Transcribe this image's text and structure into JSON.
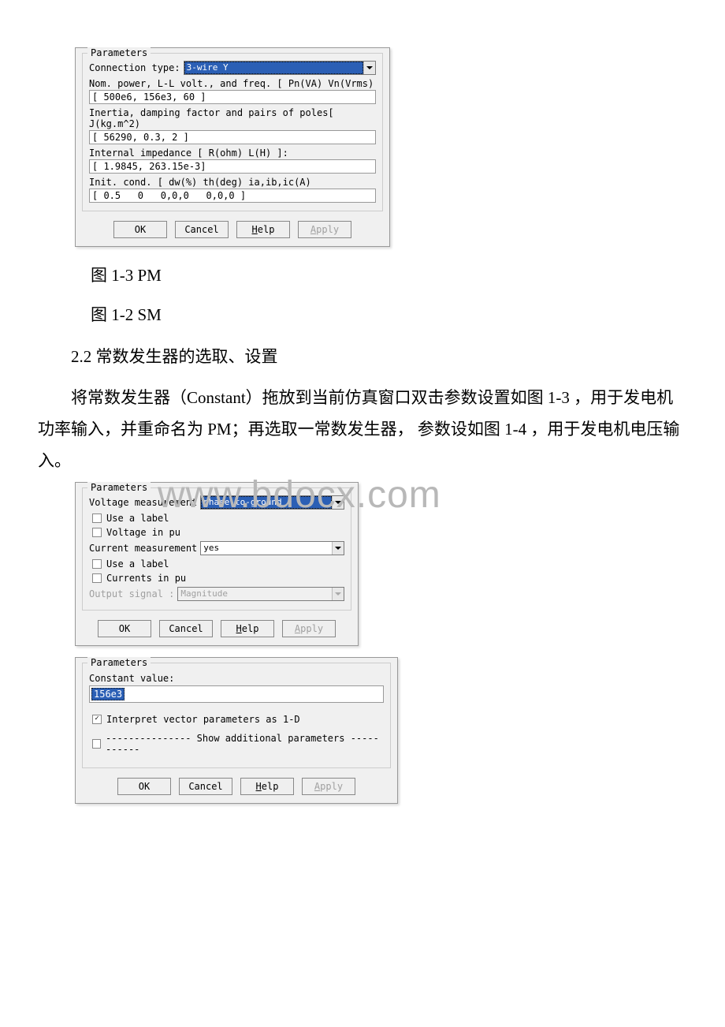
{
  "watermark": "www.bdocx.com",
  "dialog1": {
    "legend": "Parameters",
    "connection_label": "Connection type:",
    "connection_value": "3-wire Y",
    "nom_label": "Nom. power, L-L volt., and freq. [ Pn(VA) Vn(Vrms)",
    "nom_value": "[ 500e6, 156e3, 60 ]",
    "inertia_label": "Inertia, damping factor and pairs of poles[ J(kg.m^2)",
    "inertia_value": "[ 56290, 0.3, 2 ]",
    "impedance_label": "Internal impedance [ R(ohm)  L(H) ]:",
    "impedance_value": "[ 1.9845, 263.15e-3]",
    "init_label": "Init. cond. [ dw(%)  th(deg)  ia,ib,ic(A)",
    "init_value": "[ 0.5   0   0,0,0   0,0,0 ]",
    "buttons": {
      "ok": "OK",
      "cancel": "Cancel",
      "help": "Help",
      "apply": "Apply"
    }
  },
  "captions": {
    "c1": "图 1-3 PM",
    "c2": "图 1-2 SM"
  },
  "text": {
    "section": "2.2 常数发生器的选取、设置",
    "para1": "将常数发生器（Constant）拖放到当前仿真窗口双击参数设置如图 1-3 ，用于发电机功率输入，并重命名为 PM；再选取一常数发生器， 参数设如图 1-4 ，用于发电机电压输入。"
  },
  "dialog2": {
    "legend": "Parameters",
    "volt_label": "Voltage measurement",
    "volt_value": "phase-to-ground",
    "cb_use_label1": "Use a label",
    "cb_voltage_pu": "Voltage  in pu",
    "curr_label": "Current measurement",
    "curr_value": "yes",
    "cb_use_label2": "Use a label",
    "cb_currents_pu": "Currents in pu",
    "output_label": "Output signal :",
    "output_value": "Magnitude",
    "buttons": {
      "ok": "OK",
      "cancel": "Cancel",
      "help": "Help",
      "apply": "Apply"
    }
  },
  "dialog3": {
    "legend": "Parameters",
    "const_label": "Constant value:",
    "const_value": "156e3",
    "cb_interpret": "Interpret vector parameters as 1-D",
    "show_additional": "--------------- Show additional parameters -----------",
    "buttons": {
      "ok": "OK",
      "cancel": "Cancel",
      "help": "Help",
      "apply": "Apply"
    }
  }
}
